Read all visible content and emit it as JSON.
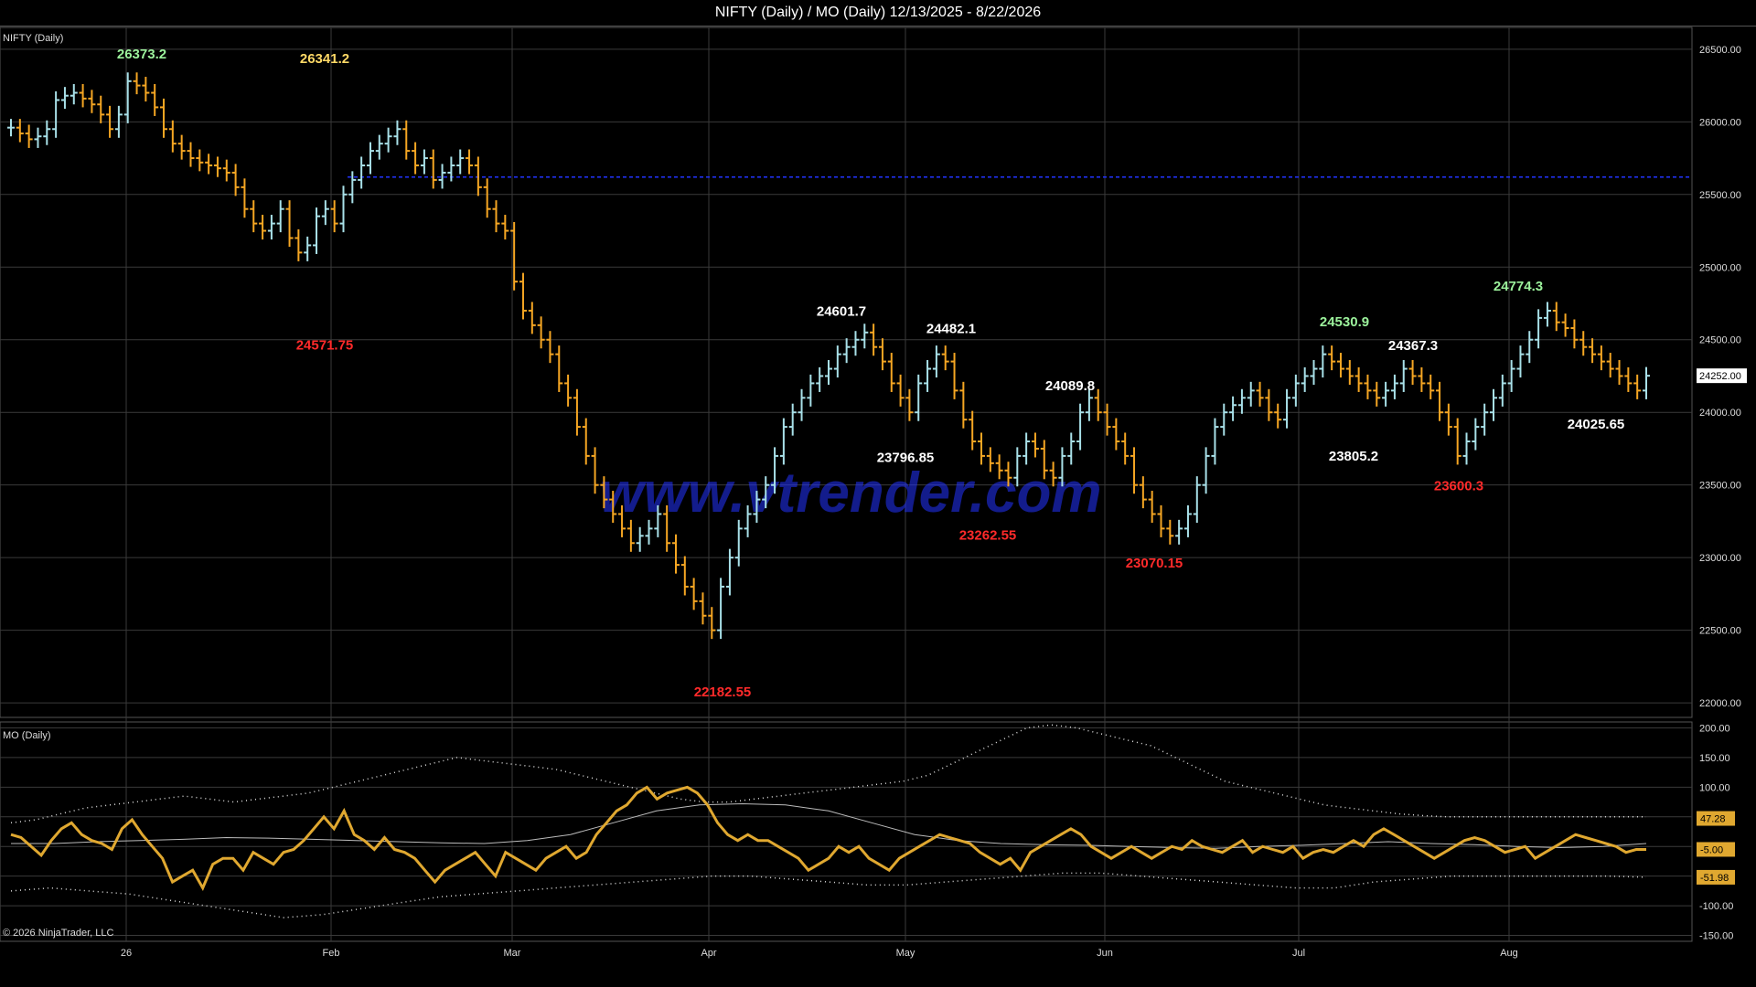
{
  "title": "NIFTY (Daily) / MO (Daily)  12/13/2025 - 8/22/2026",
  "copyright": "© 2026 NinjaTrader, LLC",
  "watermark": "www.vtrender.com",
  "colors": {
    "background": "#000000",
    "grid": "#3a3a3a",
    "up_bar": "#a8e0e8",
    "down_bar": "#f5a623",
    "profile": "#c25bb8",
    "profile_grey": "#8a8a8a",
    "poc": "#2233ff",
    "value_area": "#ff99ff",
    "high_label": "#9cf29c",
    "low_label": "#ff2a2a",
    "neutral_label": "#ffffff",
    "osc_line": "#e0a830",
    "osc_bands": "#dddddd"
  },
  "chart_data": [
    {
      "type": "line",
      "panel": "price",
      "label": "NIFTY (Daily)",
      "ylim": [
        21900,
        26650
      ],
      "y_ticks": [
        "26500.00",
        "26000.00",
        "25500.00",
        "25000.00",
        "24500.00",
        "24000.00",
        "23500.00",
        "23000.00",
        "22500.00",
        "22000.00"
      ],
      "x_ticks": [
        "26",
        "Feb",
        "Mar",
        "Apr",
        "May",
        "Jun",
        "Jul",
        "Aug"
      ],
      "last_price": "24252.00",
      "series": [
        {
          "values": [
            25960,
            25920,
            25880,
            25900,
            25950,
            26150,
            26180,
            26200,
            26160,
            26120,
            26050,
            25950,
            26050,
            26280,
            26250,
            26200,
            26100,
            25950,
            25850,
            25800,
            25750,
            25720,
            25700,
            25680,
            25650,
            25550,
            25400,
            25300,
            25250,
            25300,
            25400,
            25200,
            25100,
            25150,
            25350,
            25400,
            25300,
            25500,
            25600,
            25700,
            25800,
            25850,
            25900,
            25950,
            25800,
            25700,
            25750,
            25600,
            25650,
            25700,
            25750,
            25700,
            25550,
            25400,
            25300,
            25250,
            24900,
            24700,
            24600,
            24500,
            24400,
            24200,
            24100,
            23900,
            23700,
            23500,
            23400,
            23300,
            23200,
            23100,
            23150,
            23200,
            23300,
            23100,
            22950,
            22800,
            22700,
            22600,
            22500,
            22800,
            23000,
            23200,
            23300,
            23400,
            23500,
            23700,
            23900,
            24000,
            24100,
            24200,
            24250,
            24300,
            24400,
            24450,
            24500,
            24550,
            24450,
            24350,
            24200,
            24100,
            24000,
            24200,
            24300,
            24400,
            24350,
            24150,
            23950,
            23800,
            23700,
            23650,
            23600,
            23550,
            23700,
            23800,
            23750,
            23600,
            23550,
            23700,
            23800,
            24000,
            24100,
            24000,
            23900,
            23800,
            23700,
            23500,
            23400,
            23300,
            23200,
            23150,
            23200,
            23300,
            23500,
            23700,
            23900,
            24000,
            24050,
            24100,
            24150,
            24100,
            24000,
            23950,
            24100,
            24200,
            24250,
            24300,
            24400,
            24350,
            24300,
            24250,
            24200,
            24150,
            24100,
            24150,
            24200,
            24300,
            24250,
            24200,
            24150,
            24000,
            23900,
            23700,
            23800,
            23900,
            24000,
            24100,
            24200,
            24300,
            24400,
            24500,
            24650,
            24700,
            24620,
            24580,
            24500,
            24450,
            24400,
            24350,
            24300,
            24250,
            24200,
            24150,
            24252
          ]
        }
      ],
      "annotations": [
        {
          "text": "26373.2",
          "kind": "high",
          "x": "Jan 26",
          "y": 26373.2
        },
        {
          "text": "26341.2",
          "kind": "neutral_high",
          "x": "Feb",
          "y": 26341.2
        },
        {
          "text": "24571.75",
          "kind": "low",
          "x": "Feb",
          "y": 24571.75
        },
        {
          "text": "24601.7",
          "kind": "neutral",
          "x": "Apr",
          "y": 24601.7
        },
        {
          "text": "24482.1",
          "kind": "neutral",
          "x": "May",
          "y": 24482.1
        },
        {
          "text": "23796.85",
          "kind": "neutral",
          "x": "Apr",
          "y": 23796.85
        },
        {
          "text": "24089.8",
          "kind": "neutral",
          "x": "May",
          "y": 24089.8
        },
        {
          "text": "23262.55",
          "kind": "low",
          "x": "May",
          "y": 23262.55
        },
        {
          "text": "22182.55",
          "kind": "low",
          "x": "Apr",
          "y": 22182.55
        },
        {
          "text": "23070.15",
          "kind": "low",
          "x": "Jun",
          "y": 23070.15
        },
        {
          "text": "24530.9",
          "kind": "high",
          "x": "Jul",
          "y": 24530.9
        },
        {
          "text": "24367.3",
          "kind": "neutral",
          "x": "Jul",
          "y": 24367.3
        },
        {
          "text": "23805.2",
          "kind": "neutral",
          "x": "Jul",
          "y": 23805.2
        },
        {
          "text": "23600.3",
          "kind": "low",
          "x": "Jul",
          "y": 23600.3
        },
        {
          "text": "24774.3",
          "kind": "high",
          "x": "Aug",
          "y": 24774.3
        },
        {
          "text": "24025.65",
          "kind": "neutral",
          "x": "Aug",
          "y": 24025.65
        }
      ]
    },
    {
      "type": "line",
      "panel": "oscillator",
      "label": "MO (Daily)",
      "ylim": [
        -160,
        210
      ],
      "y_ticks": [
        "200.00",
        "150.00",
        "100.00",
        "50.00",
        "0.00",
        "-50.00",
        "-100.00",
        "-150.00"
      ],
      "markers": [
        {
          "text": "47.28",
          "value": 47.28
        },
        {
          "text": "-5.00",
          "value": -5.0
        },
        {
          "text": "-51.98",
          "value": -51.98
        }
      ],
      "series": [
        {
          "name": "MO",
          "values": [
            20,
            15,
            0,
            -15,
            10,
            30,
            40,
            20,
            10,
            5,
            -5,
            30,
            45,
            20,
            0,
            -20,
            -60,
            -50,
            -40,
            -70,
            -30,
            -20,
            -20,
            -40,
            -10,
            -20,
            -30,
            -10,
            -5,
            10,
            30,
            50,
            30,
            60,
            20,
            10,
            -5,
            15,
            -5,
            -10,
            -20,
            -40,
            -60,
            -40,
            -30,
            -20,
            -10,
            -30,
            -50,
            -10,
            -20,
            -30,
            -40,
            -20,
            -10,
            0,
            -20,
            -10,
            20,
            40,
            60,
            70,
            90,
            100,
            80,
            90,
            95,
            100,
            90,
            70,
            40,
            20,
            10,
            20,
            10,
            10,
            0,
            -10,
            -20,
            -40,
            -30,
            -20,
            0,
            -10,
            0,
            -20,
            -30,
            -40,
            -20,
            -10,
            0,
            10,
            20,
            15,
            10,
            5,
            -10,
            -20,
            -30,
            -20,
            -40,
            -10,
            0,
            10,
            20,
            30,
            20,
            0,
            -10,
            -20,
            -10,
            0,
            -10,
            -20,
            -10,
            0,
            -5,
            10,
            0,
            -5,
            -10,
            0,
            10,
            -10,
            0,
            -5,
            -10,
            0,
            -20,
            -10,
            -5,
            -10,
            0,
            10,
            0,
            20,
            30,
            20,
            10,
            0,
            -10,
            -20,
            -10,
            0,
            10,
            15,
            10,
            0,
            -10,
            -5,
            0,
            -20,
            -10,
            0,
            10,
            20,
            15,
            10,
            5,
            0,
            -10,
            -5,
            -5
          ]
        },
        {
          "name": "Upper",
          "values": [
            40,
            45,
            55,
            65,
            70,
            75,
            80,
            85,
            80,
            75,
            80,
            85,
            90,
            100,
            110,
            120,
            130,
            140,
            150,
            145,
            140,
            135,
            130,
            120,
            110,
            100,
            90,
            80,
            75,
            75,
            80,
            85,
            90,
            95,
            100,
            105,
            110,
            120,
            140,
            160,
            180,
            200,
            205,
            200,
            190,
            180,
            170,
            150,
            130,
            110,
            100,
            90,
            80,
            70,
            65,
            60,
            55,
            52,
            50,
            50,
            50,
            50,
            50,
            50,
            50,
            50,
            50
          ]
        },
        {
          "name": "Lower",
          "values": [
            -75,
            -70,
            -75,
            -80,
            -90,
            -100,
            -110,
            -120,
            -115,
            -105,
            -95,
            -85,
            -80,
            -75,
            -70,
            -65,
            -60,
            -55,
            -50,
            -50,
            -55,
            -60,
            -65,
            -65,
            -60,
            -55,
            -50,
            -45,
            -45,
            -50,
            -55,
            -60,
            -65,
            -70,
            -70,
            -60,
            -55,
            -50,
            -50,
            -50,
            -50,
            -50,
            -52
          ]
        },
        {
          "name": "Mid",
          "values": [
            5,
            5,
            8,
            10,
            12,
            15,
            14,
            12,
            10,
            8,
            6,
            5,
            10,
            20,
            40,
            60,
            70,
            72,
            70,
            60,
            40,
            20,
            10,
            5,
            3,
            2,
            0,
            -2,
            -3,
            0,
            2,
            5,
            8,
            5,
            3,
            0,
            -2,
            0,
            5
          ]
        }
      ]
    }
  ]
}
